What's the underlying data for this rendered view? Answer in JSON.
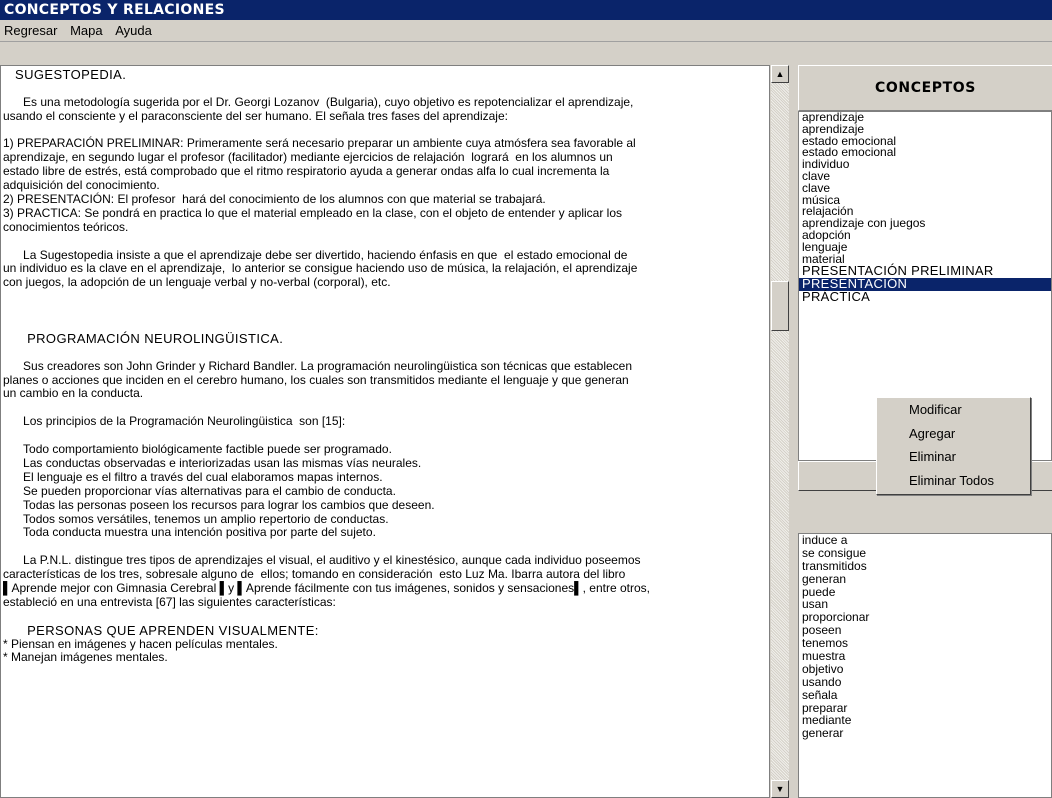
{
  "window": {
    "title": "CONCEPTOS Y RELACIONES"
  },
  "menu": [
    "Regresar",
    "Mapa",
    "Ayuda"
  ],
  "text_panel": {
    "lines": [
      {
        "t": "   SUGESTOPEDIA.",
        "h": true
      },
      {
        "t": ""
      },
      {
        "t": "      Es una metodología sugerida por el Dr. Georgi Lozanov  (Bulgaria), cuyo objetivo es repotencializar el aprendizaje,"
      },
      {
        "t": "usando el consciente y el paraconsciente del ser humano. El señala tres fases del aprendizaje:"
      },
      {
        "t": ""
      },
      {
        "t": "1) PREPARACIÓN PRELIMINAR: Primeramente será necesario preparar un ambiente cuya atmósfera sea favorable al"
      },
      {
        "t": "aprendizaje, en segundo lugar el profesor (facilitador) mediante ejercicios de relajación  logrará  en los alumnos un"
      },
      {
        "t": "estado libre de estrés, está comprobado que el ritmo respiratorio ayuda a generar ondas alfa lo cual incrementa la"
      },
      {
        "t": "adquisición del conocimiento."
      },
      {
        "t": "2) PRESENTACIÓN: El profesor  hará del conocimiento de los alumnos con que material se trabajará."
      },
      {
        "t": "3) PRACTICA: Se pondrá en practica lo que el material empleado en la clase, con el objeto de entender y aplicar los"
      },
      {
        "t": "conocimientos teóricos."
      },
      {
        "t": ""
      },
      {
        "t": "      La Sugestopedia insiste a que el aprendizaje debe ser divertido, haciendo énfasis en que  el estado emocional de"
      },
      {
        "t": "un individuo es la clave en el aprendizaje,  lo anterior se consigue haciendo uso de música, la relajación, el aprendizaje"
      },
      {
        "t": "con juegos, la adopción de un lenguaje verbal y no-verbal (corporal), etc."
      },
      {
        "t": ""
      },
      {
        "t": ""
      },
      {
        "t": ""
      },
      {
        "t": "      PROGRAMACIÓN NEUROLINGÜISTICA.",
        "h": true
      },
      {
        "t": ""
      },
      {
        "t": "      Sus creadores son John Grinder y Richard Bandler. La programación neurolingüistica son técnicas que establecen"
      },
      {
        "t": "planes o acciones que inciden en el cerebro humano, los cuales son transmitidos mediante el lenguaje y que generan"
      },
      {
        "t": "un cambio en la conducta."
      },
      {
        "t": ""
      },
      {
        "t": "      Los principios de la Programación Neurolingüistica  son [15]:"
      },
      {
        "t": ""
      },
      {
        "t": "      Todo comportamiento biológicamente factible puede ser programado."
      },
      {
        "t": "      Las conductas observadas e interiorizadas usan las mismas vías neurales."
      },
      {
        "t": "      El lenguaje es el filtro a través del cual elaboramos mapas internos."
      },
      {
        "t": "      Se pueden proporcionar vías alternativas para el cambio de conducta."
      },
      {
        "t": "      Todas las personas poseen los recursos para lograr los cambios que deseen."
      },
      {
        "t": "      Todos somos versátiles, tenemos un amplio repertorio de conductas."
      },
      {
        "t": "      Toda conducta muestra una intención positiva por parte del sujeto."
      },
      {
        "t": ""
      },
      {
        "t": "      La P.N.L. distingue tres tipos de aprendizajes el visual, el auditivo y el kinestésico, aunque cada individuo poseemos"
      },
      {
        "t": "características de los tres, sobresale alguno de  ellos; tomando en consideración  esto Luz Ma. Ibarra autora del libro"
      },
      {
        "t": "▌Aprende mejor con Gimnasia Cerebral ▌y ▌Aprende fácilmente con tus imágenes, sonidos y sensaciones▌, entre otros,"
      },
      {
        "t": "estableció en una entrevista [67] las siguientes características:"
      },
      {
        "t": ""
      },
      {
        "t": "      PERSONAS QUE APRENDEN VISUALMENTE:",
        "h": true
      },
      {
        "t": "* Piensan en imágenes y hacen películas mentales."
      },
      {
        "t": "* Manejan imágenes mentales."
      }
    ]
  },
  "scroll": {
    "up_glyph": "▲",
    "down_glyph": "▼"
  },
  "conceptos": {
    "header": "CONCEPTOS",
    "items": [
      {
        "label": "aprendizaje"
      },
      {
        "label": "aprendizaje"
      },
      {
        "label": "estado emocional"
      },
      {
        "label": "estado emocional"
      },
      {
        "label": "individuo"
      },
      {
        "label": "clave"
      },
      {
        "label": "clave"
      },
      {
        "label": "música"
      },
      {
        "label": "relajación"
      },
      {
        "label": "aprendizaje con juegos"
      },
      {
        "label": "adopción"
      },
      {
        "label": "lenguaje"
      },
      {
        "label": "material"
      },
      {
        "label": "PRESENTACIÓN PRELIMINAR",
        "big": true
      },
      {
        "label": "PRESENTACIÓN",
        "big": true,
        "selected": true
      },
      {
        "label": "PRÁCTICA",
        "big": true
      }
    ]
  },
  "context_menu": [
    "Modificar",
    "Agregar",
    "Eliminar",
    "Eliminar Todos"
  ],
  "relaciones": {
    "items": [
      "induce a",
      "se consigue",
      "transmitidos",
      "generan",
      "puede",
      "usan",
      "proporcionar",
      "poseen",
      "tenemos",
      "muestra",
      "objetivo",
      "usando",
      "señala",
      "preparar",
      "mediante",
      "generar"
    ]
  },
  "colors": {
    "titlebar": "#0a246a",
    "selection": "#0a246a",
    "face": "#d4d0c8"
  }
}
